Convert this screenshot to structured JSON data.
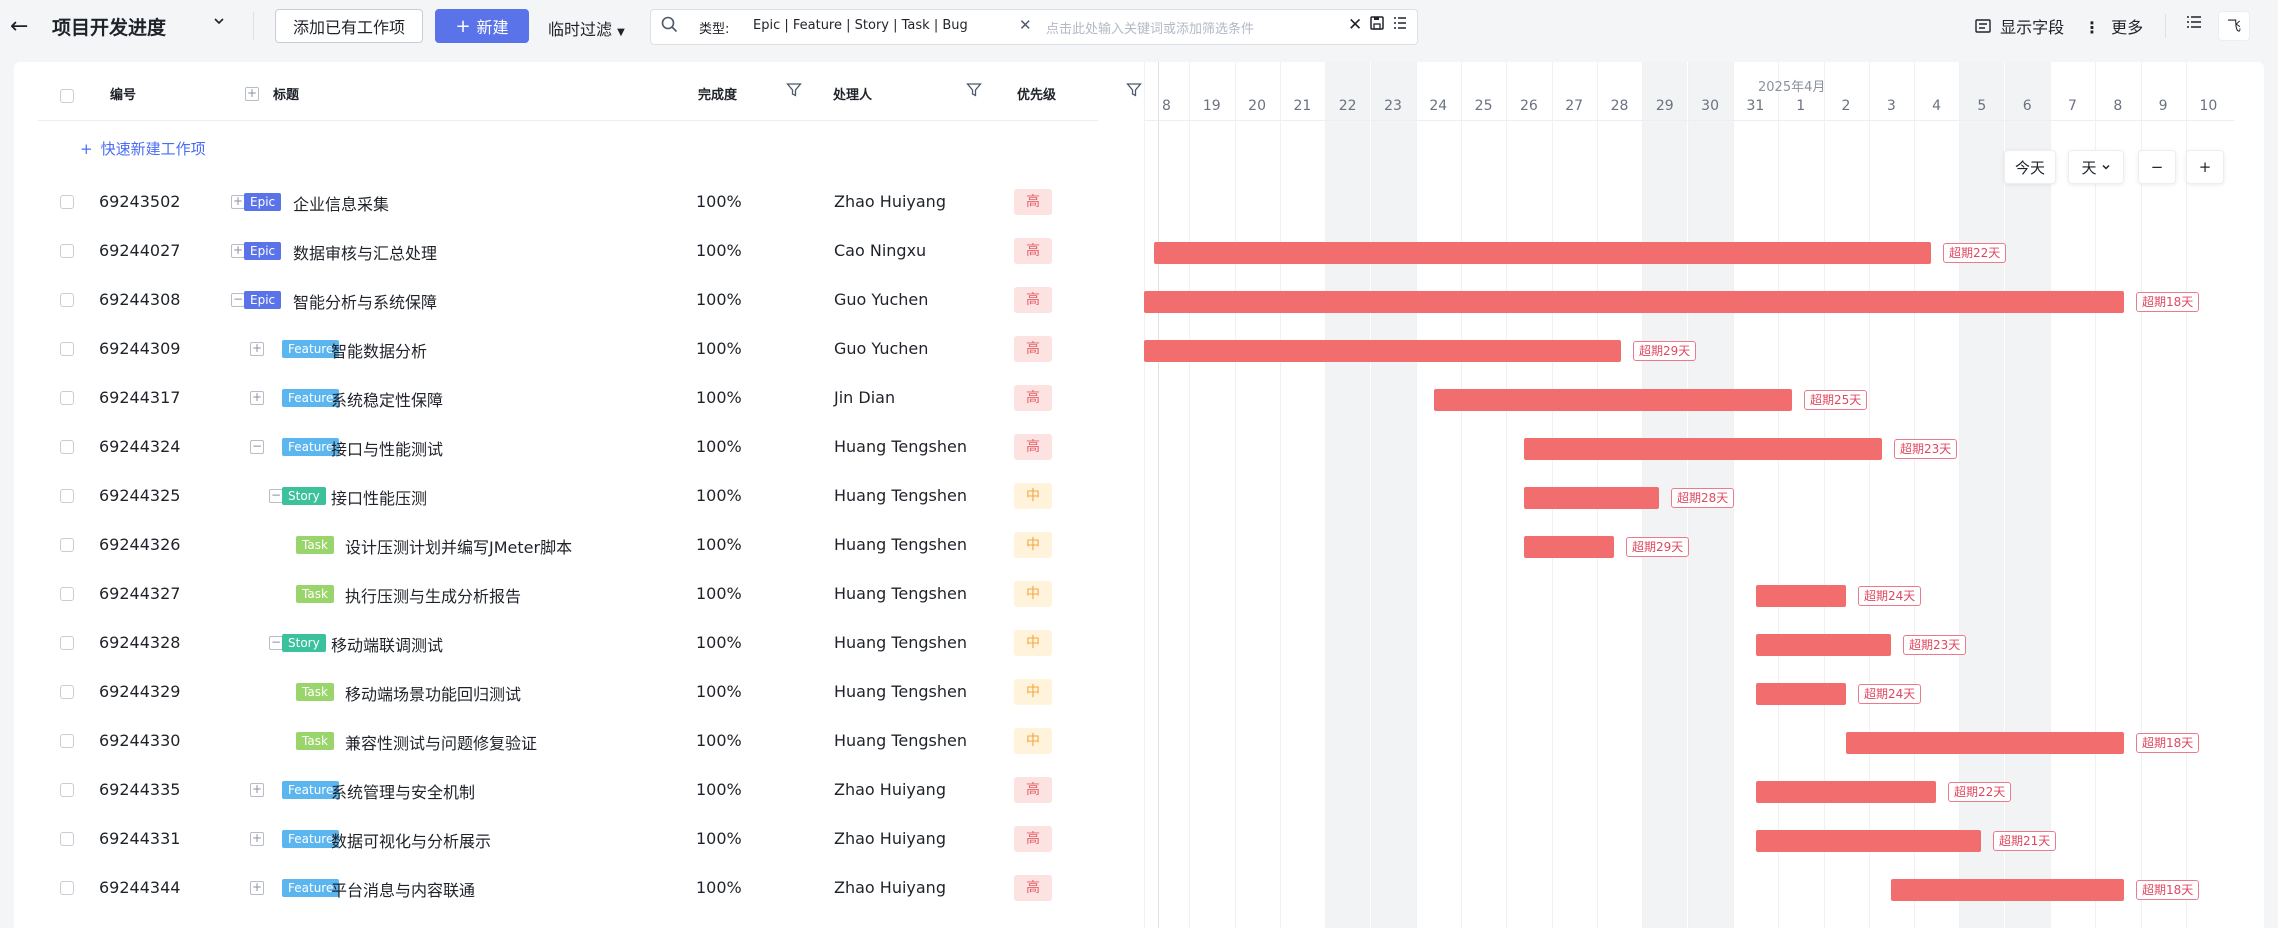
{
  "header": {
    "project_title": "项目开发进度",
    "add_existing": "添加已有工作项",
    "new_label": "新建",
    "temp_filter": "临时过滤",
    "filter_label": "类型:",
    "filter_types": "Epic  |  Feature  |  Story  |  Task  |  Bug",
    "search_placeholder": "点击此处输入关键词或添加筛选条件",
    "show_fields": "显示字段",
    "more": "更多",
    "view_label": "飞"
  },
  "columns": {
    "id": "编号",
    "title": "标题",
    "completion": "完成度",
    "assignee": "处理人",
    "priority": "优先级"
  },
  "quick_add": "快速新建工作项",
  "rows": [
    {
      "id": "69243502",
      "type": "Epic",
      "title": "企业信息采集",
      "completion": "100%",
      "assignee": "Zhao Huiyang",
      "priority": "高"
    },
    {
      "id": "69244027",
      "type": "Epic",
      "title": "数据审核与汇总处理",
      "completion": "100%",
      "assignee": "Cao Ningxu",
      "priority": "高"
    },
    {
      "id": "69244308",
      "type": "Epic",
      "title": "智能分析与系统保障",
      "completion": "100%",
      "assignee": "Guo Yuchen",
      "priority": "高"
    },
    {
      "id": "69244309",
      "type": "Feature",
      "title": "智能数据分析",
      "completion": "100%",
      "assignee": "Guo Yuchen",
      "priority": "高"
    },
    {
      "id": "69244317",
      "type": "Feature",
      "title": "系统稳定性保障",
      "completion": "100%",
      "assignee": "Jin Dian",
      "priority": "高"
    },
    {
      "id": "69244324",
      "type": "Feature",
      "title": "接口与性能测试",
      "completion": "100%",
      "assignee": "Huang Tengshen",
      "priority": "高"
    },
    {
      "id": "69244325",
      "type": "Story",
      "title": "接口性能压测",
      "completion": "100%",
      "assignee": "Huang Tengshen",
      "priority": "中"
    },
    {
      "id": "69244326",
      "type": "Task",
      "title": "设计压测计划并编写JMeter脚本",
      "completion": "100%",
      "assignee": "Huang Tengshen",
      "priority": "中"
    },
    {
      "id": "69244327",
      "type": "Task",
      "title": "执行压测与生成分析报告",
      "completion": "100%",
      "assignee": "Huang Tengshen",
      "priority": "中"
    },
    {
      "id": "69244328",
      "type": "Story",
      "title": "移动端联调测试",
      "completion": "100%",
      "assignee": "Huang Tengshen",
      "priority": "中"
    },
    {
      "id": "69244329",
      "type": "Task",
      "title": "移动端场景功能回归测试",
      "completion": "100%",
      "assignee": "Huang Tengshen",
      "priority": "中"
    },
    {
      "id": "69244330",
      "type": "Task",
      "title": "兼容性测试与问题修复验证",
      "completion": "100%",
      "assignee": "Huang Tengshen",
      "priority": "中"
    },
    {
      "id": "69244335",
      "type": "Feature",
      "title": "系统管理与安全机制",
      "completion": "100%",
      "assignee": "Zhao Huiyang",
      "priority": "高"
    },
    {
      "id": "69244331",
      "type": "Feature",
      "title": "数据可视化与分析展示",
      "completion": "100%",
      "assignee": "Zhao Huiyang",
      "priority": "高"
    },
    {
      "id": "69244344",
      "type": "Feature",
      "title": "平台消息与内容联通",
      "completion": "100%",
      "assignee": "Zhao Huiyang",
      "priority": "高"
    }
  ],
  "gantt": {
    "month_label": "2025年4月",
    "days": [
      "8",
      "19",
      "20",
      "21",
      "22",
      "23",
      "24",
      "25",
      "26",
      "27",
      "28",
      "29",
      "30",
      "31",
      "1",
      "2",
      "3",
      "4",
      "5",
      "6",
      "7",
      "8",
      "9",
      "10"
    ],
    "weekend_days": [
      "22",
      "23",
      "29",
      "30",
      "5",
      "6"
    ],
    "today_btn": "今天",
    "scale_btn": "天",
    "zoom_out": "−",
    "zoom_in": "+",
    "overdue_labels": [
      "",
      "超期22天",
      "超期18天",
      "超期29天",
      "超期25天",
      "超期23天",
      "超期28天",
      "超期29天",
      "超期24天",
      "超期23天",
      "超期24天",
      "超期18天",
      "超期22天",
      "超期21天",
      "超期18天"
    ]
  },
  "colors": {
    "primary": "#5b73e8",
    "bar": "#f26d6d",
    "epic": "#5b73e8",
    "feature": "#5bb6f0",
    "story": "#3cc19d",
    "task": "#9ad56c"
  }
}
